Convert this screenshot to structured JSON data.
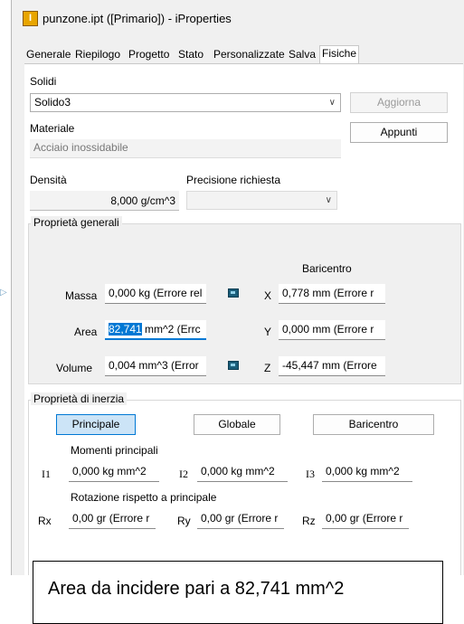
{
  "window": {
    "title": "punzone.ipt ([Primario]) - iProperties",
    "app_icon_letter": "I"
  },
  "tabs": [
    {
      "label": "Generale"
    },
    {
      "label": "Riepilogo"
    },
    {
      "label": "Progetto"
    },
    {
      "label": "Stato"
    },
    {
      "label": "Personalizzate"
    },
    {
      "label": "Salva"
    },
    {
      "label": "Fisiche"
    }
  ],
  "active_tab": "Fisiche",
  "solids": {
    "label": "Solidi",
    "value": "Solido3",
    "update_button": "Aggiorna"
  },
  "material": {
    "label": "Materiale",
    "value": "Acciaio inossidabile",
    "clipboard_button": "Appunti"
  },
  "density": {
    "label": "Densità",
    "value": "8,000 g/cm^3"
  },
  "precision": {
    "label": "Precisione richiesta",
    "value": ""
  },
  "general": {
    "title": "Proprietà generali",
    "centroid_header": "Baricentro",
    "mass_label": "Massa",
    "mass_value": "0,000 kg (Errore rel",
    "area_label": "Area",
    "area_selected": "82,741",
    "area_rest": " mm^2 (Errc",
    "volume_label": "Volume",
    "volume_value": "0,004 mm^3 (Error",
    "x_label": "X",
    "x_value": "0,778 mm (Errore r",
    "y_label": "Y",
    "y_value": "0,000 mm (Errore r",
    "z_label": "Z",
    "z_value": "-45,447 mm (Errore"
  },
  "inertia": {
    "title": "Proprietà di inerzia",
    "btn_principal": "Principale",
    "btn_global": "Globale",
    "btn_centroid": "Baricentro",
    "principal_moments_label": "Momenti principali",
    "i1_label": "I1",
    "i1_value": "0,000 kg mm^2",
    "i2_label": "I2",
    "i2_value": "0,000 kg mm^2",
    "i3_label": "I3",
    "i3_value": "0,000 kg mm^2",
    "rotation_label": "Rotazione rispetto a principale",
    "rx_label": "Rx",
    "rx_value": "0,00 gr (Errore r",
    "ry_label": "Ry",
    "ry_value": "0,00 gr (Errore r",
    "rz_label": "Rz",
    "rz_value": "0,00 gr (Errore r"
  },
  "caption": "Area da incidere pari a 82,741 mm^2",
  "colors": {
    "accent": "#0078d4",
    "selection": "#0078d4",
    "pressed_button": "#cce4f7"
  },
  "icons": {
    "app": "inventor-part-icon",
    "calculator": "calculator-icon",
    "dropdown": "chevron-down-icon"
  }
}
